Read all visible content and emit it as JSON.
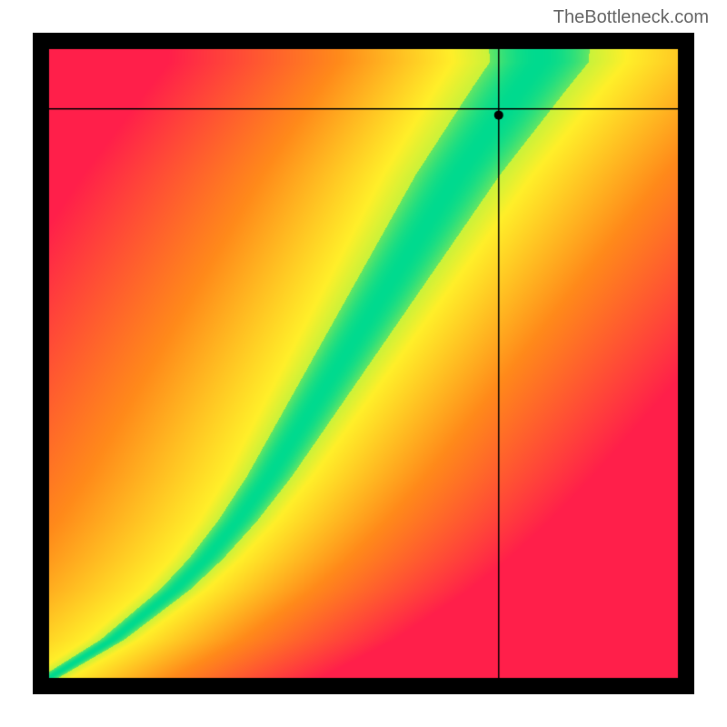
{
  "watermark": "TheBottleneck.com",
  "chart_data": {
    "type": "heatmap",
    "title": "",
    "xlabel": "",
    "ylabel": "",
    "xlim": [
      0,
      1
    ],
    "ylim": [
      0,
      1
    ],
    "crosshair": {
      "x": 0.715,
      "y": 0.095
    },
    "marker": {
      "x": 0.715,
      "y": 0.105
    },
    "color_scale": {
      "low": "#ff1f4a",
      "mid_low": "#ff8a00",
      "mid": "#ffef29",
      "optimal": "#00da8e",
      "description": "Green band along a curved diagonal (bottleneck-free), yellow transition, orange then red away from the band. Band widens toward the top."
    },
    "curve_description": "S-shaped diagonal from bottom-left to upper-middle-right. Starts near (0,1) in plot coords going to roughly (0.78, 0.02) at top.",
    "series": [
      {
        "name": "optimal_band_center",
        "x": [
          0.0,
          0.05,
          0.1,
          0.15,
          0.2,
          0.25,
          0.3,
          0.35,
          0.4,
          0.45,
          0.5,
          0.55,
          0.6,
          0.65,
          0.7,
          0.75,
          0.78
        ],
        "y": [
          1.0,
          0.97,
          0.94,
          0.9,
          0.86,
          0.81,
          0.75,
          0.68,
          0.6,
          0.52,
          0.44,
          0.36,
          0.28,
          0.2,
          0.13,
          0.06,
          0.02
        ]
      }
    ]
  }
}
